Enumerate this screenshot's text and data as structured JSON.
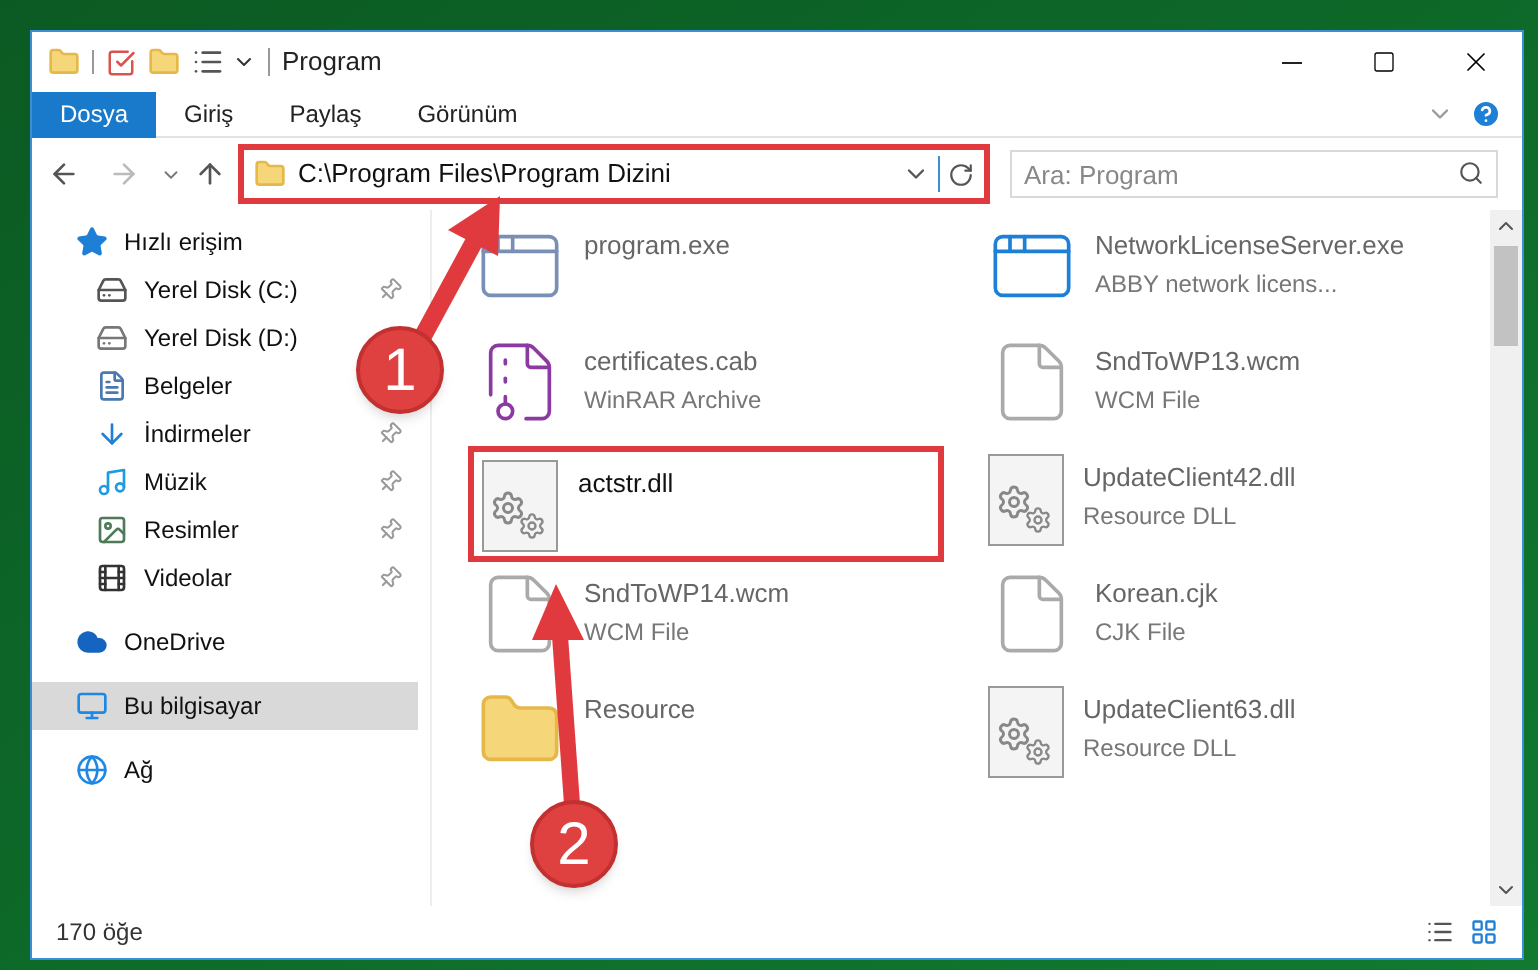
{
  "window": {
    "title": "Program"
  },
  "ribbon_tabs": [
    {
      "label": "Dosya",
      "selected": true
    },
    {
      "label": "Giriş",
      "selected": false
    },
    {
      "label": "Paylaş",
      "selected": false
    },
    {
      "label": "Görünüm",
      "selected": false
    }
  ],
  "address": {
    "path": "C:\\Program Files\\Program Dizini",
    "highlighted": true
  },
  "search": {
    "placeholder": "Ara: Program"
  },
  "sidebar": {
    "items": [
      {
        "label": "Hızlı erişim",
        "kind": "star",
        "selected": false,
        "children": [
          {
            "label": "Yerel Disk (C:)",
            "kind": "drive-c",
            "pinned": true,
            "selected": false
          },
          {
            "label": "Yerel Disk (D:)",
            "kind": "drive",
            "pinned": false,
            "selected": false
          },
          {
            "label": "Belgeler",
            "kind": "documents",
            "pinned": false,
            "selected": false
          },
          {
            "label": "İndirmeler",
            "kind": "downloads",
            "pinned": true,
            "selected": false
          },
          {
            "label": "Müzik",
            "kind": "music",
            "pinned": true,
            "selected": false
          },
          {
            "label": "Resimler",
            "kind": "pictures",
            "pinned": true,
            "selected": false
          },
          {
            "label": "Videolar",
            "kind": "videos",
            "pinned": true,
            "selected": false
          }
        ]
      },
      {
        "label": "OneDrive",
        "kind": "cloud",
        "selected": false
      },
      {
        "label": "Bu bilgisayar",
        "kind": "computer",
        "selected": true
      },
      {
        "label": "Ağ",
        "kind": "network",
        "selected": false
      }
    ]
  },
  "files": [
    {
      "name": "program.exe",
      "kind": "exe",
      "blurred": true,
      "highlighted": false
    },
    {
      "name": "NetworkLicenseServer.exe",
      "type": "ABBY network licens...",
      "kind": "app",
      "blurred": true,
      "highlighted": false
    },
    {
      "name": "certificates.cab",
      "type": "WinRAR Archive",
      "kind": "archive",
      "blurred": true,
      "highlighted": false
    },
    {
      "name": "SndToWP13.wcm",
      "type": "WCM File",
      "kind": "blank",
      "blurred": true,
      "highlighted": false
    },
    {
      "name": "actstr.dll",
      "kind": "dll",
      "blurred": false,
      "highlighted": true
    },
    {
      "name": "UpdateClient42.dll",
      "type": "Resource DLL",
      "kind": "dll",
      "blurred": true,
      "highlighted": false
    },
    {
      "name": "SndToWP14.wcm",
      "type": "WCM File",
      "kind": "blank",
      "blurred": true,
      "highlighted": false
    },
    {
      "name": "Korean.cjk",
      "type": "CJK File",
      "kind": "blank",
      "blurred": true,
      "highlighted": false
    },
    {
      "name": "Resource",
      "kind": "folder",
      "blurred": true,
      "highlighted": false
    },
    {
      "name": "UpdateClient63.dll",
      "type": "Resource DLL",
      "kind": "dll",
      "blurred": true,
      "highlighted": false
    }
  ],
  "status_bar": {
    "count": "170 öğe"
  },
  "annotations": [
    {
      "number": "1"
    },
    {
      "number": "2"
    }
  ]
}
